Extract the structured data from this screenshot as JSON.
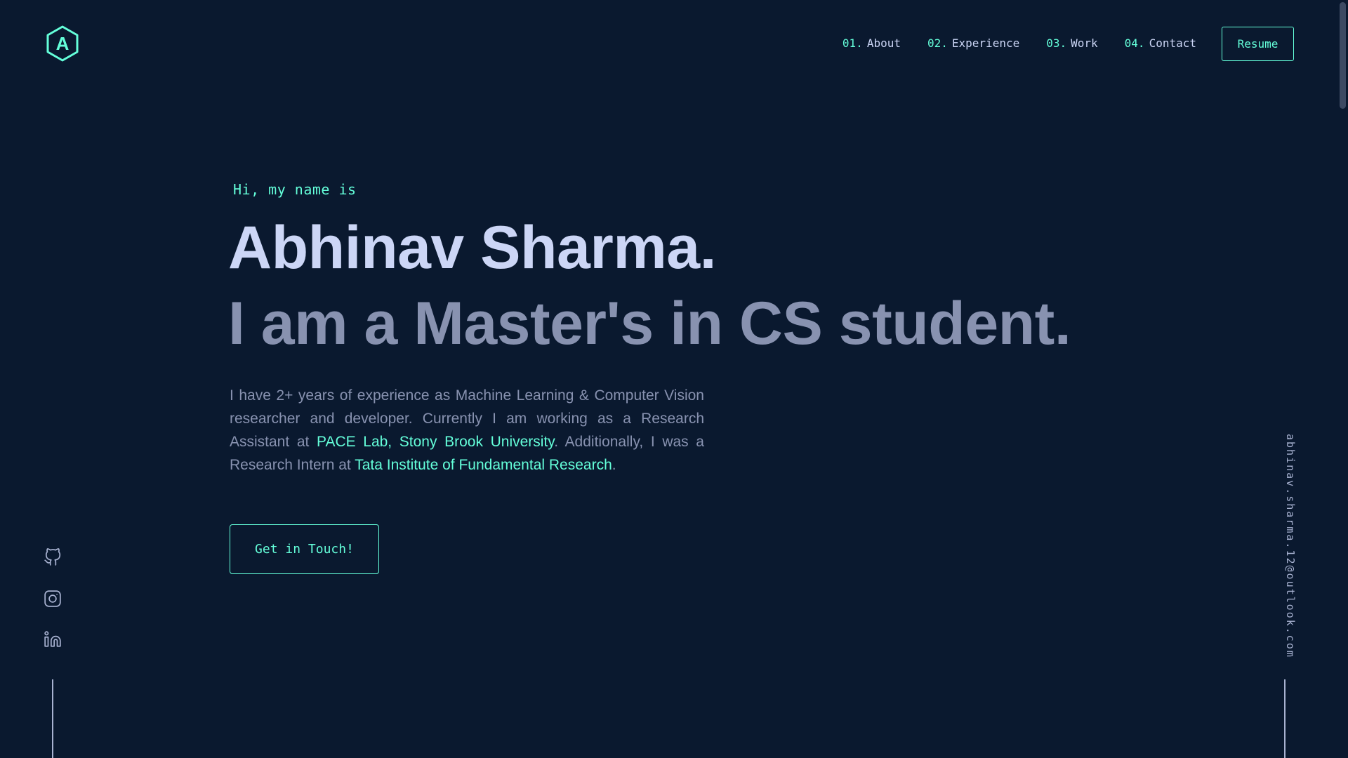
{
  "header": {
    "logo_letter": "A",
    "nav": [
      {
        "num": "01.",
        "label": "About"
      },
      {
        "num": "02.",
        "label": "Experience"
      },
      {
        "num": "03.",
        "label": "Work"
      },
      {
        "num": "04.",
        "label": "Contact"
      }
    ],
    "resume_label": "Resume"
  },
  "hero": {
    "greeting": "Hi, my name is",
    "name": "Abhinav Sharma.",
    "tagline": "I am a Master's in CS student.",
    "intro": {
      "part1": "I have 2+ years of experience as Machine Learning & Computer Vision researcher and developer. Currently I am working as a Research Assistant at ",
      "link1": "PACE Lab, Stony Brook University",
      "part2": ". Additionally, I was a Research Intern at ",
      "link2": "Tata Institute of Fundamental Research",
      "part3": "."
    },
    "cta_label": "Get in Touch!"
  },
  "social": [
    {
      "icon": "github-icon"
    },
    {
      "icon": "instagram-icon"
    },
    {
      "icon": "linkedin-icon"
    }
  ],
  "email": "abhinav.sharma.12@outlook.com",
  "colors": {
    "background": "#0a192f",
    "accent": "#64ffda",
    "heading": "#ccd6f6",
    "text": "#8892b0"
  }
}
